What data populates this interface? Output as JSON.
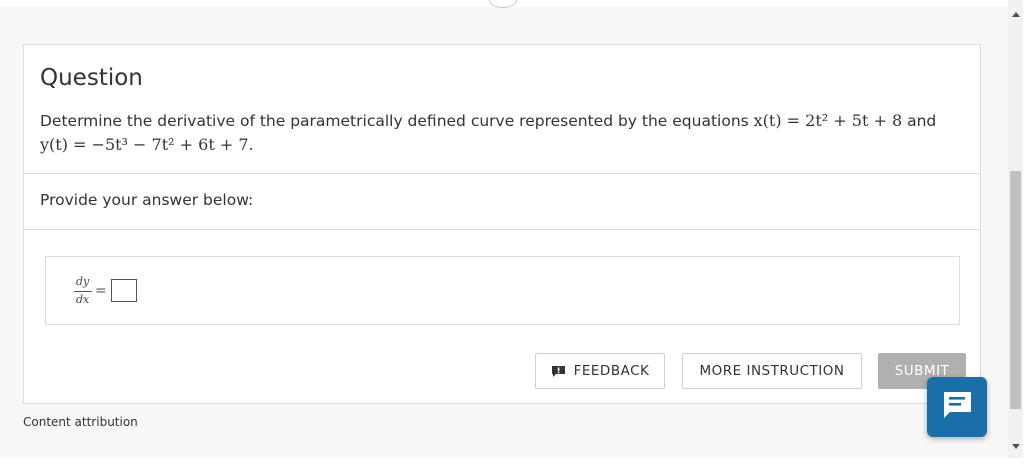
{
  "question": {
    "title": "Question",
    "text_intro": "Determine the derivative of the parametrically defined curve represented by the equations ",
    "x_eq": "x(t) = 2t² + 5t + 8",
    "and": " and ",
    "y_eq": "y(t) = −5t³ − 7t² + 6t + 7",
    "period": "."
  },
  "prompt": "Provide your answer below:",
  "answer": {
    "numerator": "dy",
    "denominator": "dx",
    "equals": "=",
    "value": ""
  },
  "buttons": {
    "feedback": "FEEDBACK",
    "more_instruction": "MORE INSTRUCTION",
    "submit": "SUBMIT"
  },
  "footer": {
    "attribution": "Content attribution"
  },
  "colors": {
    "chat_accent": "#1b6fa8",
    "submit_disabled": "#b0b0b0"
  },
  "icons": {
    "feedback": "feedback-alert-icon",
    "chat": "chat-bubble-icon",
    "scroll_up": "scroll-up-arrow-icon",
    "scroll_down": "scroll-down-arrow-icon"
  }
}
